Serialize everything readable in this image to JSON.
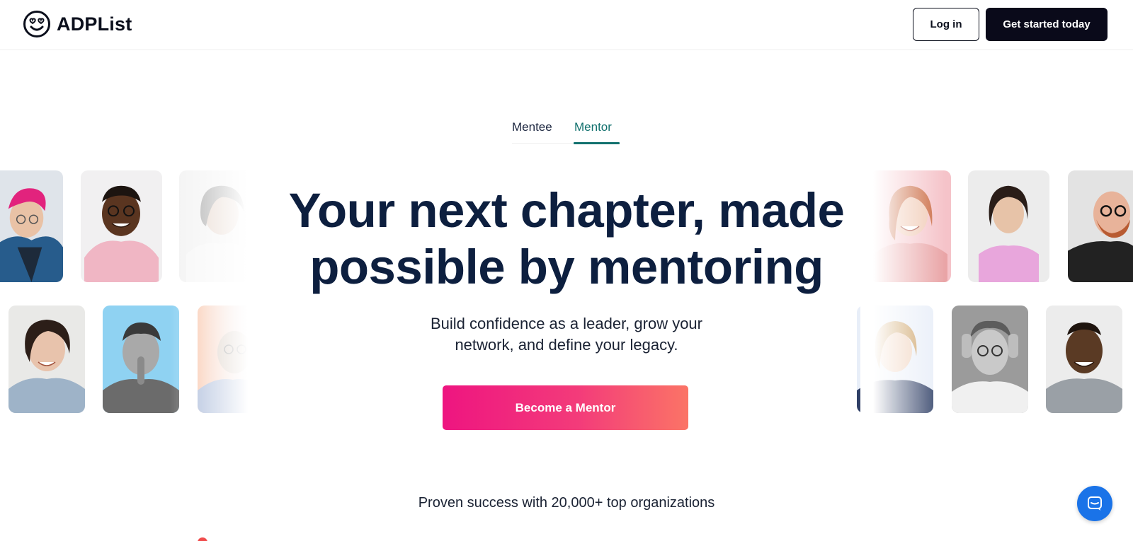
{
  "brand": {
    "name": "ADPList",
    "logo_icon": "smiley-heart-eyes-icon"
  },
  "header": {
    "login_label": "Log in",
    "cta_label": "Get started today"
  },
  "tabs": [
    {
      "label": "Mentee",
      "active": false
    },
    {
      "label": "Mentor",
      "active": true
    }
  ],
  "hero": {
    "title_line1": "Your next chapter, made",
    "title_line2": "possible by mentoring",
    "subtitle_line1": "Build confidence as a leader, grow your",
    "subtitle_line2": "network, and define your legacy.",
    "cta_label": "Become a Mentor"
  },
  "proof": {
    "text": "Proven success with 20,000+ top organizations"
  },
  "colors": {
    "accent_teal": "#12716e",
    "heading_navy": "#0d1f3f",
    "cta_gradient_start": "#ee1580",
    "cta_gradient_end": "#fb7466",
    "chat_blue": "#1a73e8"
  },
  "chat": {
    "icon": "chat-bubble-icon"
  }
}
